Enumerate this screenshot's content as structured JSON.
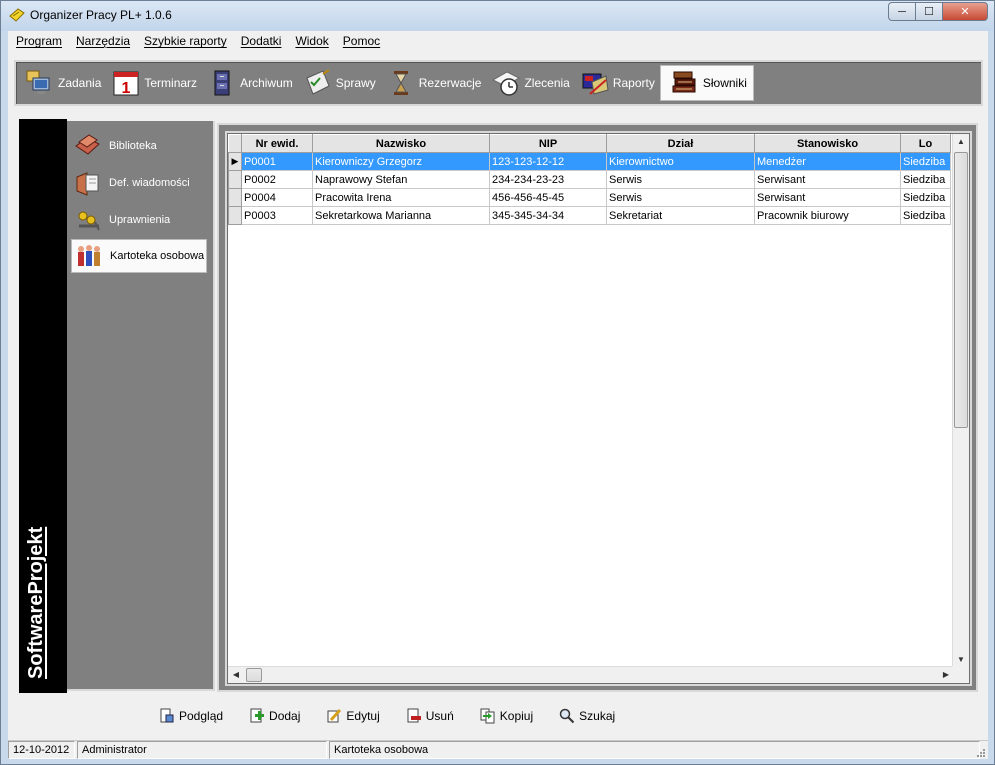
{
  "window": {
    "title": "Organizer Pracy PL+ 1.0.6",
    "minimize": "─",
    "maximize": "☐",
    "close": "✕"
  },
  "menu": [
    "Program",
    "Narzędzia",
    "Szybkie raporty",
    "Dodatki",
    "Widok",
    "Pomoc"
  ],
  "toolbar": [
    {
      "label": "Zadania",
      "icon": "computer-icon"
    },
    {
      "label": "Terminarz",
      "icon": "calendar-icon"
    },
    {
      "label": "Archiwum",
      "icon": "cabinet-icon"
    },
    {
      "label": "Sprawy",
      "icon": "checklist-icon"
    },
    {
      "label": "Rezerwacje",
      "icon": "hourglass-icon"
    },
    {
      "label": "Zlecenia",
      "icon": "clock-paper-icon"
    },
    {
      "label": "Raporty",
      "icon": "report-icon"
    },
    {
      "label": "Słowniki",
      "icon": "books-icon",
      "active": true
    }
  ],
  "brand": "SoftwareProjekt",
  "nav": [
    {
      "label": "Biblioteka",
      "icon": "library-icon"
    },
    {
      "label": "Def. wiadomości",
      "icon": "message-definition-icon"
    },
    {
      "label": "Uprawnienia",
      "icon": "permissions-icon"
    },
    {
      "label": "Kartoteka osobowa",
      "icon": "people-icon",
      "active": true
    }
  ],
  "grid": {
    "columns": [
      "Nr ewid.",
      "Nazwisko",
      "NIP",
      "Dział",
      "Stanowisko",
      "Lo"
    ],
    "rows": [
      {
        "selected": true,
        "cells": [
          "P0001",
          "Kierowniczy Grzegorz",
          "123-123-12-12",
          "Kierownictwo",
          "Menedżer",
          "Siedziba"
        ]
      },
      {
        "selected": false,
        "cells": [
          "P0002",
          "Naprawowy Stefan",
          "234-234-23-23",
          "Serwis",
          "Serwisant",
          "Siedziba"
        ]
      },
      {
        "selected": false,
        "cells": [
          "P0004",
          "Pracowita Irena",
          "456-456-45-45",
          "Serwis",
          "Serwisant",
          "Siedziba"
        ]
      },
      {
        "selected": false,
        "cells": [
          "P0003",
          "Sekretarkowa Marianna",
          "345-345-34-34",
          "Sekretariat",
          "Pracownik biurowy",
          "Siedziba"
        ]
      }
    ],
    "row_indicator": "▶"
  },
  "actions": [
    {
      "label": "Podgląd",
      "icon": "preview-icon"
    },
    {
      "label": "Dodaj",
      "icon": "add-icon"
    },
    {
      "label": "Edytuj",
      "icon": "edit-icon"
    },
    {
      "label": "Usuń",
      "icon": "delete-icon"
    },
    {
      "label": "Kopiuj",
      "icon": "copy-icon"
    },
    {
      "label": "Szukaj",
      "icon": "search-icon"
    }
  ],
  "status": {
    "date": "12-10-2012",
    "user": "Administrator",
    "module": "Kartoteka osobowa"
  },
  "colors": {
    "selection": "#3399ff",
    "panel": "#808080"
  }
}
